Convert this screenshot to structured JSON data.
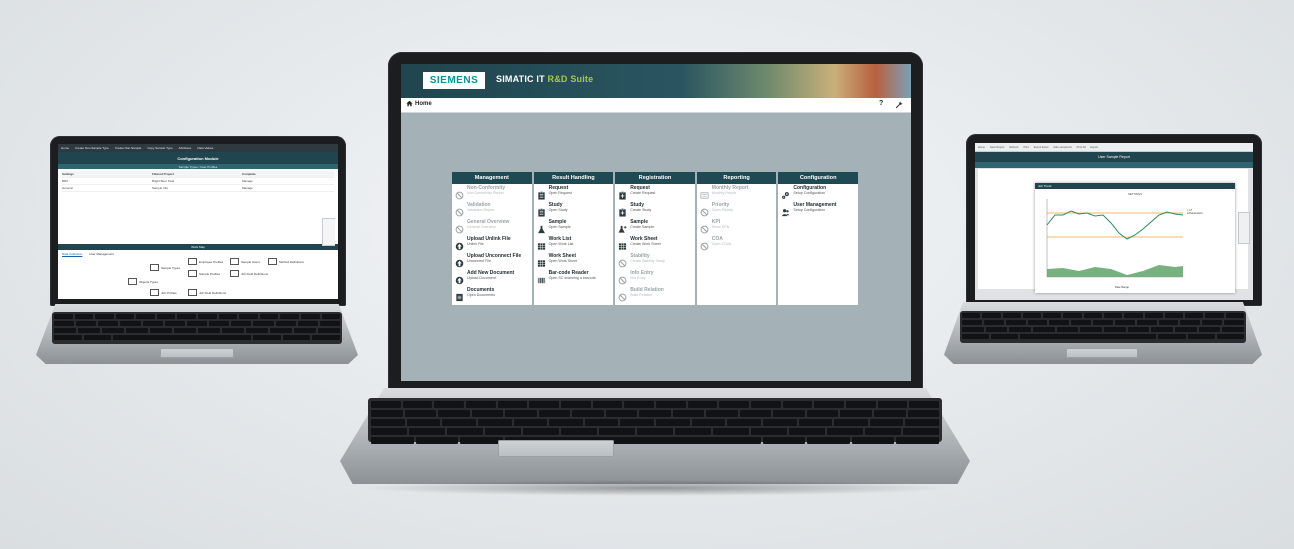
{
  "left_laptop": {
    "toolbar": [
      "Home",
      "Create Non-Sample Type",
      "Create Non-Sample",
      "Copy Sample Type",
      "Attributes",
      "Data Values"
    ],
    "title": "Configuration Module",
    "subtitle": "Sample Types / User Profiles",
    "table_header": [
      "Settings",
      "Filtered Project",
      "Complete"
    ],
    "rows": [
      {
        "name": "BRX",
        "value": "Bright Beer Tank",
        "state": "Manage"
      },
      {
        "name": "General",
        "value": "Sample Info",
        "state": "Manage"
      }
    ],
    "band": "Work Map",
    "links": [
      "Data Collection",
      "User Management"
    ],
    "nodes": [
      "Sample Types",
      "Employee Profiles",
      "Sample Users",
      "Sample Profiles",
      "Job Field Definitions",
      "Method Definitions",
      "Objects Types",
      "Job Profiles",
      "Job Field Definitions"
    ]
  },
  "center": {
    "brand_logo": "SIEMENS",
    "brand_name": "SIMATIC IT",
    "brand_suite": "R&D Suite",
    "nav_home": "Home",
    "nav_help": "?",
    "columns": [
      {
        "title": "Management",
        "items": [
          {
            "title": "Non-Conformity",
            "sub": "Non Conformity Report",
            "icon": "no-icon",
            "disabled": true
          },
          {
            "title": "Validation",
            "sub": "Validation Report",
            "icon": "no-icon",
            "disabled": true
          },
          {
            "title": "General Overview",
            "sub": "General Overview",
            "icon": "no-icon",
            "disabled": true
          },
          {
            "title": "Upload Unlink File",
            "sub": "Unlink File",
            "icon": "link-icon",
            "disabled": false
          },
          {
            "title": "Upload Unconnect File",
            "sub": "Unconnect File",
            "icon": "link-icon",
            "disabled": false
          },
          {
            "title": "Add New Document",
            "sub": "Upload Document",
            "icon": "link-icon",
            "disabled": false
          },
          {
            "title": "Documents",
            "sub": "Open Documents",
            "icon": "document-icon",
            "disabled": false
          }
        ]
      },
      {
        "title": "Result Handling",
        "items": [
          {
            "title": "Request",
            "sub": "Open Request",
            "icon": "clipboard-icon",
            "disabled": false
          },
          {
            "title": "Study",
            "sub": "Open Study",
            "icon": "clipboard-icon",
            "disabled": false
          },
          {
            "title": "Sample",
            "sub": "Open Sample",
            "icon": "flask-icon",
            "disabled": false
          },
          {
            "title": "Work List",
            "sub": "Open Work List",
            "icon": "grid-icon",
            "disabled": false
          },
          {
            "title": "Work Sheet",
            "sub": "Open Work Sheet",
            "icon": "grid-icon",
            "disabled": false
          },
          {
            "title": "Bar-code Reader",
            "sub": "Open SC scanning a barcode",
            "icon": "barcode-icon",
            "disabled": false
          }
        ]
      },
      {
        "title": "Registration",
        "items": [
          {
            "title": "Request",
            "sub": "Create Request",
            "icon": "clipboard-plus-icon",
            "disabled": false
          },
          {
            "title": "Study",
            "sub": "Create Study",
            "icon": "clipboard-plus-icon",
            "disabled": false
          },
          {
            "title": "Sample",
            "sub": "Create Sample",
            "icon": "flask-plus-icon",
            "disabled": false
          },
          {
            "title": "Work Sheet",
            "sub": "Create Work Sheet",
            "icon": "grid-icon",
            "disabled": false
          },
          {
            "title": "Stability",
            "sub": "Create Stability Study",
            "icon": "no-icon",
            "disabled": true
          },
          {
            "title": "Info Entry",
            "sub": "Info Entry",
            "icon": "no-icon",
            "disabled": true
          },
          {
            "title": "Build Relation",
            "sub": "Build Relation",
            "icon": "no-icon",
            "disabled": true
          }
        ]
      },
      {
        "title": "Reporting",
        "items": [
          {
            "title": "Monthly Report",
            "sub": "Monthly Report",
            "icon": "report-icon",
            "disabled": true
          },
          {
            "title": "Priority",
            "sub": "Open Priority",
            "icon": "no-icon",
            "disabled": true
          },
          {
            "title": "KPI",
            "sub": "Show KPIs",
            "icon": "no-icon",
            "disabled": true
          },
          {
            "title": "COA",
            "sub": "Open COAs",
            "icon": "no-icon",
            "disabled": true
          }
        ]
      },
      {
        "title": "Configuration",
        "items": [
          {
            "title": "Configuration",
            "sub": "Setup Configuration",
            "icon": "gears-icon",
            "disabled": false
          },
          {
            "title": "User Management",
            "sub": "Setup Configuration",
            "icon": "users-icon",
            "disabled": false
          }
        ]
      }
    ]
  },
  "right_laptop": {
    "toolbar": [
      "Home",
      "Save Report",
      "Refresh",
      "Print",
      "Export Excel",
      "Hide sample list",
      "Print All",
      "Export"
    ],
    "title": "User Sample Report",
    "dialog_title": "Job Trend",
    "chart_title": "SETTINGS",
    "legend": [
      "LT",
      "Parameters"
    ],
    "xlabel": "Date Range",
    "colors": {
      "line": "#2e8b57",
      "limit": "#f0a030",
      "area": "#5fa36a"
    }
  },
  "colors": {
    "teal_dark": "#1f4a53",
    "screen_bg": "#a4b2b8",
    "accent_green": "#a5c84e",
    "siemens_teal": "#009999"
  }
}
